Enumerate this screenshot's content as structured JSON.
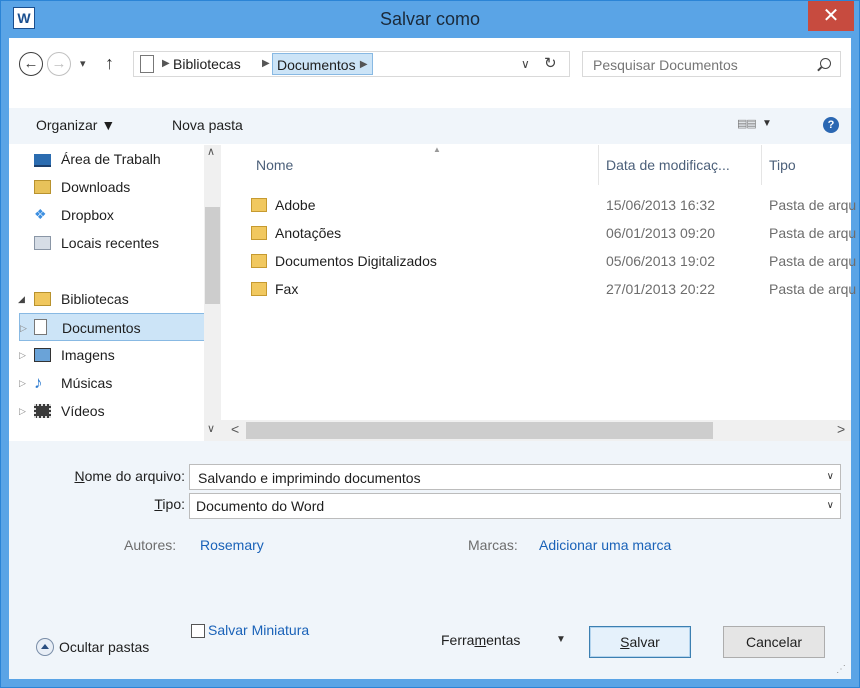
{
  "window": {
    "title": "Salvar como",
    "app_icon": "W",
    "close_glyph": "✕"
  },
  "nav": {
    "back_icon": "back-arrow-icon",
    "forward_icon": "forward-arrow-icon",
    "up_icon": "up-arrow-icon",
    "breadcrumb": [
      "Bibliotecas",
      "Documentos"
    ],
    "search_placeholder": "Pesquisar Documentos"
  },
  "toolbar": {
    "organize_label": "Organizar ▼",
    "new_folder_label": "Nova pasta",
    "help_glyph": "?"
  },
  "sidebar": {
    "items": [
      {
        "label": "Área de Trabalh",
        "icon": "desktop-icon"
      },
      {
        "label": "Downloads",
        "icon": "downloads-folder-icon"
      },
      {
        "label": "Dropbox",
        "icon": "dropbox-icon"
      },
      {
        "label": "Locais recentes",
        "icon": "recent-places-icon"
      },
      {
        "label": "Bibliotecas",
        "icon": "libraries-icon"
      },
      {
        "label": "Documentos",
        "icon": "documents-icon",
        "selected": true
      },
      {
        "label": "Imagens",
        "icon": "pictures-icon"
      },
      {
        "label": "Músicas",
        "icon": "music-icon"
      },
      {
        "label": "Vídeos",
        "icon": "videos-icon"
      }
    ]
  },
  "file_list": {
    "columns": [
      "Nome",
      "Data de modificaç...",
      "Tipo"
    ],
    "rows": [
      {
        "name": "Adobe",
        "date": "15/06/2013 16:32",
        "type": "Pasta de arqu"
      },
      {
        "name": "Anotações",
        "date": "06/01/2013 09:20",
        "type": "Pasta de arqu"
      },
      {
        "name": "Documentos Digitalizados",
        "date": "05/06/2013 19:02",
        "type": "Pasta de arqu"
      },
      {
        "name": "Fax",
        "date": "27/01/2013 20:22",
        "type": "Pasta de arqu"
      }
    ]
  },
  "form": {
    "filename_label_u": "N",
    "filename_label_rest": "ome do arquivo:",
    "filename_value": "Salvando e imprimindo documentos",
    "type_label_u": "T",
    "type_label_rest": "ipo:",
    "type_value": "Documento do Word",
    "authors_label": "Autores:",
    "authors_value": "Rosemary",
    "tags_label": "Marcas:",
    "tags_value": "Adicionar uma marca",
    "thumbnail_label": "Salvar Miniatura",
    "thumbnail_checked": false
  },
  "footer": {
    "hide_folders_label": "Ocultar pastas",
    "tools_pre": "Ferra",
    "tools_u": "m",
    "tools_post": "entas",
    "save_u": "S",
    "save_rest": "alvar",
    "cancel_label": "Cancelar"
  }
}
